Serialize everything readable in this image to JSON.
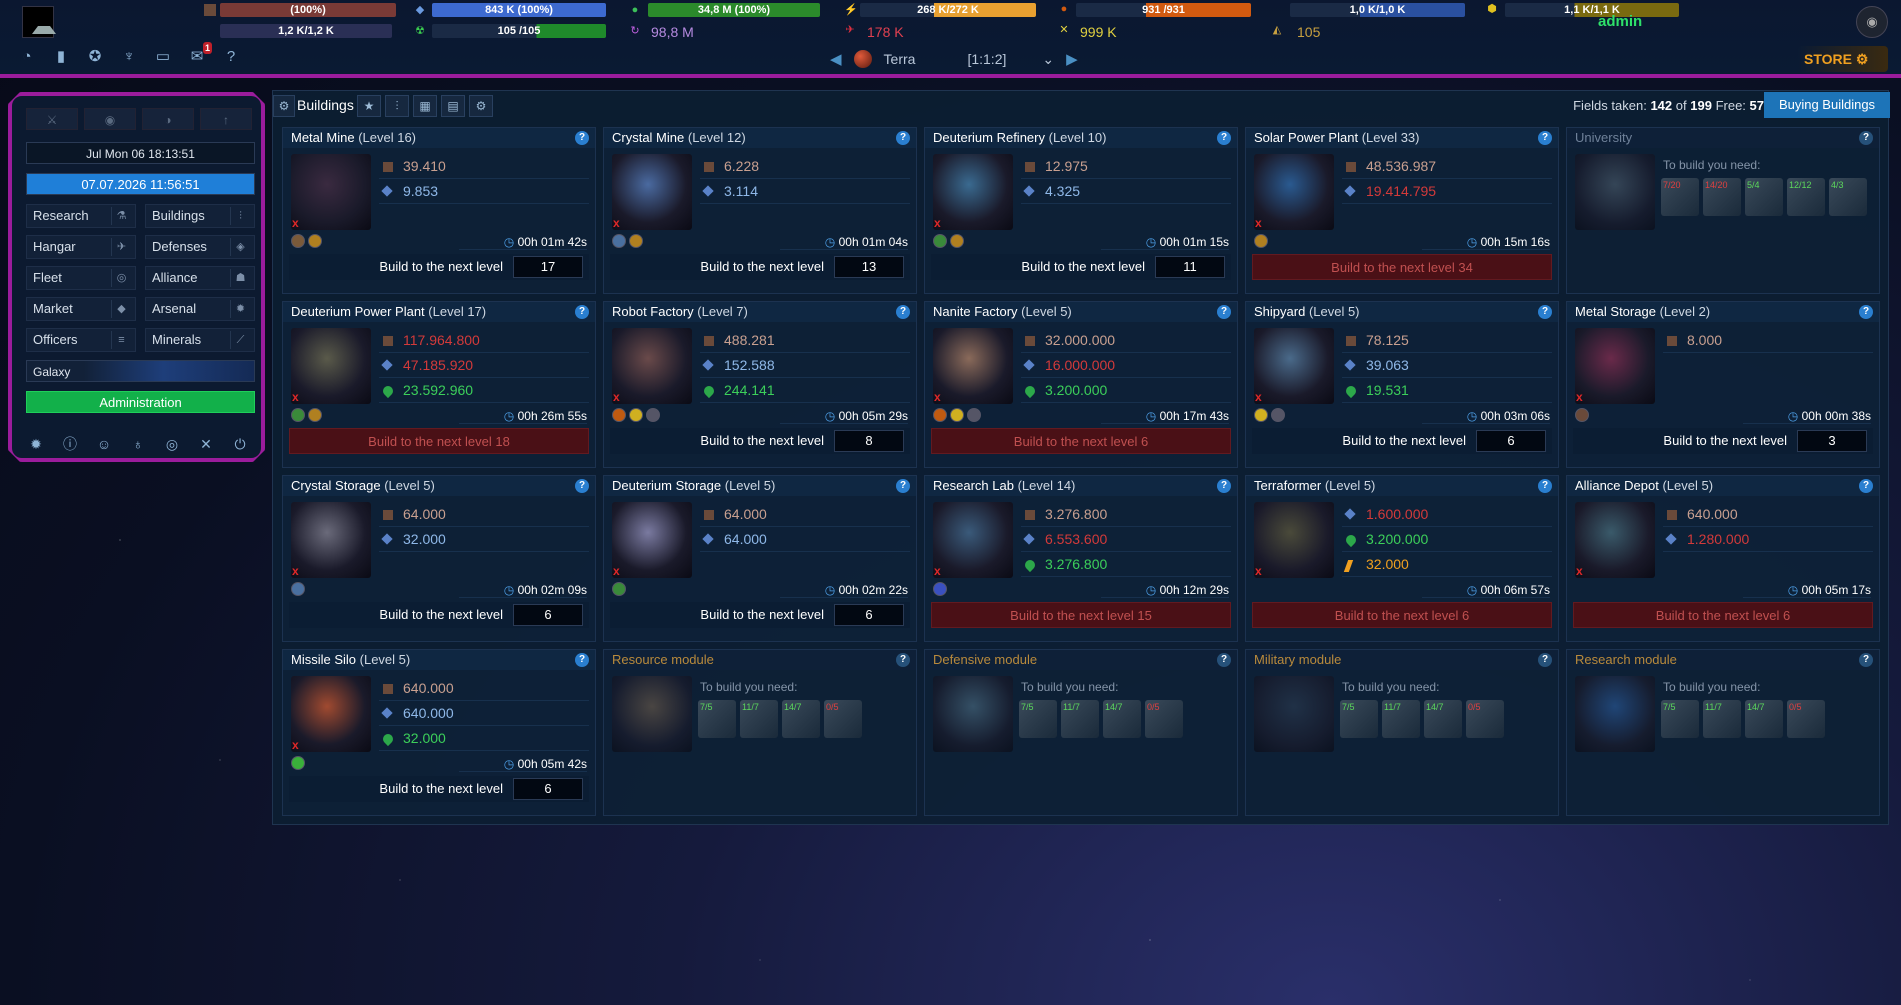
{
  "top": {
    "resources_row1": [
      {
        "name": "metal-bar",
        "text": "(100%)",
        "color": "#7a3a36"
      },
      {
        "name": "crystal-bar",
        "text": "843 K (100%)",
        "color": "#3d6ad0"
      },
      {
        "name": "deuterium-bar",
        "text": "34,8 M (100%)",
        "color": "#2b8a2b"
      },
      {
        "name": "energy-bar",
        "text": "268 K/272 K",
        "color": "#e8a030"
      },
      {
        "name": "darkmatter-bar",
        "text": "931 /931",
        "color": "#d25a10"
      },
      {
        "name": "fleet-bar",
        "text": "1,0 K/1,0 K",
        "color": "#2a50a0"
      },
      {
        "name": "building-bar",
        "text": "1,1 K/1,1 K",
        "color": "#7a6a10"
      }
    ],
    "resources_row2": [
      {
        "name": "storage-bar",
        "text": "1,2 K/1,2 K"
      },
      {
        "name": "population-bar",
        "text": "105 /105"
      }
    ],
    "plain_values": {
      "antimatter": "98,8 M",
      "fleet_points": "178 K",
      "battle_points": "999 K",
      "missiles": "105"
    },
    "user": "admin",
    "store": "STORE",
    "planet_name": "Terra",
    "planet_coords": "[1:1:2]",
    "messages_badge": "1",
    "help": "?"
  },
  "sidebar": {
    "server_time": "Jul Mon 06 18:13:51",
    "active_date": "07.07.2026 11:56:51",
    "nav": [
      {
        "label": "Research",
        "key": "research"
      },
      {
        "label": "Buildings",
        "key": "buildings"
      },
      {
        "label": "Hangar",
        "key": "hangar"
      },
      {
        "label": "Defenses",
        "key": "defenses"
      },
      {
        "label": "Fleet",
        "key": "fleet"
      },
      {
        "label": "Alliance",
        "key": "alliance"
      },
      {
        "label": "Market",
        "key": "market"
      },
      {
        "label": "Arsenal",
        "key": "arsenal"
      },
      {
        "label": "Officers",
        "key": "officers"
      },
      {
        "label": "Minerals",
        "key": "minerals"
      }
    ],
    "galaxy": "Galaxy",
    "administration": "Administration"
  },
  "main": {
    "title": "Buildings",
    "fields_label": "Fields taken:",
    "fields_taken": "142",
    "of_label": "of",
    "fields_total": "199",
    "free_label": "Free:",
    "free": "57",
    "buy_button": "Buying Buildings",
    "build_label": "Build to the next level",
    "need_label": "To build you need:",
    "buildings": [
      {
        "name": "Metal Mine",
        "level": "(Level 16)",
        "costs": [
          [
            "metal",
            "39.410",
            "okm"
          ],
          [
            "crystal",
            "9.853",
            "ok"
          ]
        ],
        "time": "00h 01m 42s",
        "next": "17",
        "red": false
      },
      {
        "name": "Crystal Mine",
        "level": "(Level 12)",
        "costs": [
          [
            "metal",
            "6.228",
            "okm"
          ],
          [
            "crystal",
            "3.114",
            "ok"
          ]
        ],
        "time": "00h 01m 04s",
        "next": "13",
        "red": false
      },
      {
        "name": "Deuterium Refinery",
        "level": "(Level 10)",
        "costs": [
          [
            "metal",
            "12.975",
            "okm"
          ],
          [
            "crystal",
            "4.325",
            "ok"
          ]
        ],
        "time": "00h 01m 15s",
        "next": "11",
        "red": false
      },
      {
        "name": "Solar Power Plant",
        "level": "(Level 33)",
        "costs": [
          [
            "metal",
            "48.536.987",
            "okm"
          ],
          [
            "crystal",
            "19.414.795",
            "bad"
          ]
        ],
        "time": "00h 15m 16s",
        "next": "Build to the next level 34",
        "red": true
      },
      {
        "name": "Deuterium Power Plant",
        "level": "(Level 17)",
        "costs": [
          [
            "metal",
            "117.964.800",
            "bad"
          ],
          [
            "crystal",
            "47.185.920",
            "bad"
          ],
          [
            "deut",
            "23.592.960",
            "okd"
          ]
        ],
        "time": "00h 26m 55s",
        "next": "Build to the next level 18",
        "red": true
      },
      {
        "name": "Robot Factory",
        "level": "(Level 7)",
        "costs": [
          [
            "metal",
            "488.281",
            "okm"
          ],
          [
            "crystal",
            "152.588",
            "ok"
          ],
          [
            "deut",
            "244.141",
            "okd"
          ]
        ],
        "time": "00h 05m 29s",
        "next": "8",
        "red": false
      },
      {
        "name": "Nanite Factory",
        "level": "(Level 5)",
        "costs": [
          [
            "metal",
            "32.000.000",
            "okm"
          ],
          [
            "crystal",
            "16.000.000",
            "bad"
          ],
          [
            "deut",
            "3.200.000",
            "okd"
          ]
        ],
        "time": "00h 17m 43s",
        "next": "Build to the next level 6",
        "red": true
      },
      {
        "name": "Shipyard",
        "level": "(Level 5)",
        "costs": [
          [
            "metal",
            "78.125",
            "okm"
          ],
          [
            "crystal",
            "39.063",
            "ok"
          ],
          [
            "deut",
            "19.531",
            "okd"
          ]
        ],
        "time": "00h 03m 06s",
        "next": "6",
        "red": false
      },
      {
        "name": "Metal Storage",
        "level": "(Level 2)",
        "costs": [
          [
            "metal",
            "8.000",
            "okm"
          ]
        ],
        "time": "00h 00m 38s",
        "next": "3",
        "red": false
      },
      {
        "name": "Crystal Storage",
        "level": "(Level 5)",
        "costs": [
          [
            "metal",
            "64.000",
            "okm"
          ],
          [
            "crystal",
            "32.000",
            "ok"
          ]
        ],
        "time": "00h 02m 09s",
        "next": "6",
        "red": false
      },
      {
        "name": "Deuterium Storage",
        "level": "(Level 5)",
        "costs": [
          [
            "metal",
            "64.000",
            "okm"
          ],
          [
            "crystal",
            "64.000",
            "ok"
          ]
        ],
        "time": "00h 02m 22s",
        "next": "6",
        "red": false
      },
      {
        "name": "Research Lab",
        "level": "(Level 14)",
        "costs": [
          [
            "metal",
            "3.276.800",
            "okm"
          ],
          [
            "crystal",
            "6.553.600",
            "bad"
          ],
          [
            "deut",
            "3.276.800",
            "okd"
          ]
        ],
        "time": "00h 12m 29s",
        "next": "Build to the next level 15",
        "red": true
      },
      {
        "name": "Terraformer",
        "level": "(Level 5)",
        "costs": [
          [
            "crystal",
            "1.600.000",
            "bad"
          ],
          [
            "deut",
            "3.200.000",
            "okd"
          ],
          [
            "energy",
            "32.000",
            "oke"
          ]
        ],
        "time": "00h 06m 57s",
        "next": "Build to the next level 6",
        "red": true
      },
      {
        "name": "Alliance Depot",
        "level": "(Level 5)",
        "costs": [
          [
            "metal",
            "640.000",
            "okm"
          ],
          [
            "crystal",
            "1.280.000",
            "bad"
          ]
        ],
        "time": "00h 05m 17s",
        "next": "Build to the next level 6",
        "red": true
      },
      {
        "name": "Missile Silo",
        "level": "(Level 5)",
        "costs": [
          [
            "metal",
            "640.000",
            "okm"
          ],
          [
            "crystal",
            "640.000",
            "ok"
          ],
          [
            "deut",
            "32.000",
            "okd"
          ]
        ],
        "time": "00h 05m 42s",
        "next": "6",
        "red": false
      }
    ],
    "locked": [
      {
        "name": "University",
        "reqs": [
          "7/20",
          "14/20",
          "5/4",
          "12/12",
          "4/3"
        ],
        "mod": false
      },
      {
        "name": "Resource module",
        "reqs": [
          "7/5",
          "11/7",
          "14/7",
          "0/5"
        ],
        "mod": true
      },
      {
        "name": "Defensive module",
        "reqs": [
          "7/5",
          "11/7",
          "14/7",
          "0/5"
        ],
        "mod": true
      },
      {
        "name": "Military module",
        "reqs": [
          "7/5",
          "11/7",
          "14/7",
          "0/5"
        ],
        "mod": true
      },
      {
        "name": "Research module",
        "reqs": [
          "7/5",
          "11/7",
          "14/7",
          "0/5"
        ],
        "mod": true
      }
    ]
  }
}
